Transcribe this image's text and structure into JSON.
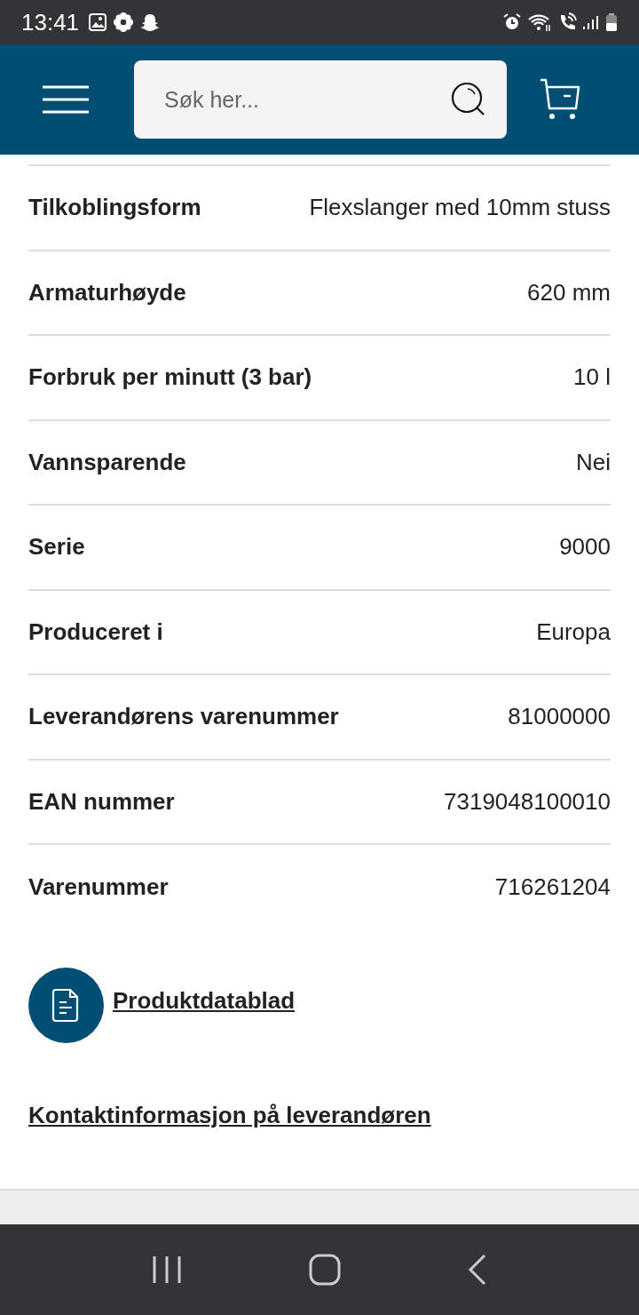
{
  "status_bar": {
    "time": "13:41"
  },
  "header": {
    "search": {
      "placeholder": "Søk her..."
    }
  },
  "specs": [
    {
      "label": "Tilkoblingsform",
      "value": "Flexslanger med 10mm stuss"
    },
    {
      "label": "Armaturhøyde",
      "value": "620 mm"
    },
    {
      "label": "Forbruk per minutt (3 bar)",
      "value": "10 l"
    },
    {
      "label": "Vannsparende",
      "value": "Nei"
    },
    {
      "label": "Serie",
      "value": "9000"
    },
    {
      "label": "Produceret i",
      "value": "Europa"
    },
    {
      "label": "Leverandørens varenummer",
      "value": "81000000"
    },
    {
      "label": "EAN nummer",
      "value": "7319048100010"
    },
    {
      "label": "Varenummer",
      "value": "716261204"
    }
  ],
  "datasheet_link": "Produktdatablad",
  "contact_link": "Kontaktinformasjon på leverandøren"
}
